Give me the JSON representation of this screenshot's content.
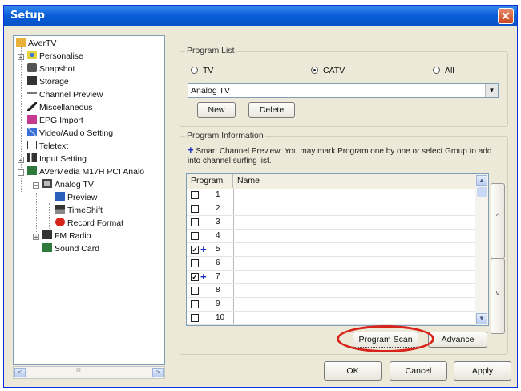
{
  "window": {
    "title": "Setup",
    "close_symbol": "✕"
  },
  "tree": {
    "items": [
      {
        "label": "AVerTV"
      },
      {
        "label": "Personalise"
      },
      {
        "label": "Snapshot"
      },
      {
        "label": "Storage"
      },
      {
        "label": "Channel Preview"
      },
      {
        "label": "Miscellaneous"
      },
      {
        "label": "EPG Import"
      },
      {
        "label": "Video/Audio Setting"
      },
      {
        "label": "Teletext"
      },
      {
        "label": "Input Setting"
      },
      {
        "label": "AVerMedia M17H PCI Analo"
      },
      {
        "label": "Analog TV"
      },
      {
        "label": "Preview"
      },
      {
        "label": "TimeShift"
      },
      {
        "label": "Record Format"
      },
      {
        "label": "FM Radio"
      },
      {
        "label": "Sound Card"
      }
    ],
    "scroll_left": "<",
    "scroll_right": ">",
    "scroll_thumb": "III"
  },
  "program_list": {
    "legend": "Program List",
    "radios": [
      {
        "label": "TV",
        "selected": false
      },
      {
        "label": "CATV",
        "selected": true
      },
      {
        "label": "All",
        "selected": false
      }
    ],
    "dropdown_value": "Analog TV",
    "dropdown_arrow": "▼",
    "new_label": "New",
    "delete_label": "Delete"
  },
  "program_info": {
    "legend": "Program Information",
    "plus_symbol": "+",
    "hint": "Smart Channel Preview: You may mark Program one by one or select Group to add into channel surfing list.",
    "col_program": "Program",
    "col_name": "Name",
    "rows": [
      {
        "num": "1",
        "checked": false,
        "plus": false
      },
      {
        "num": "2",
        "checked": false,
        "plus": false
      },
      {
        "num": "3",
        "checked": false,
        "plus": false
      },
      {
        "num": "4",
        "checked": false,
        "plus": false
      },
      {
        "num": "5",
        "checked": true,
        "plus": true
      },
      {
        "num": "6",
        "checked": false,
        "plus": false
      },
      {
        "num": "7",
        "checked": true,
        "plus": true
      },
      {
        "num": "8",
        "checked": false,
        "plus": false
      },
      {
        "num": "9",
        "checked": false,
        "plus": false
      },
      {
        "num": "10",
        "checked": false,
        "plus": false
      }
    ],
    "scroll_up": "▲",
    "scroll_down": "▼",
    "side_up": "^",
    "side_down": "v",
    "program_scan_label": "Program Scan",
    "advance_label": "Advance"
  },
  "footer": {
    "ok_label": "OK",
    "cancel_label": "Cancel",
    "apply_label": "Apply"
  },
  "colors": {
    "title_bar": "#0a5fd8",
    "highlight_ring": "#d8231b",
    "plus": "#1a2dbf"
  }
}
